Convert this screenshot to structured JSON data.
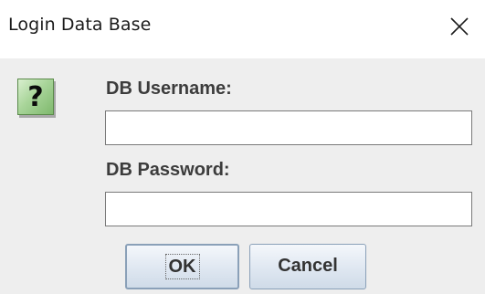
{
  "window": {
    "title": "Login Data Base",
    "close_icon": "close-icon"
  },
  "icon": {
    "name": "question-icon",
    "glyph": "?",
    "color": "#8cc47b"
  },
  "form": {
    "username_label": "DB Username:",
    "username_value": "",
    "password_label": "DB Password:",
    "password_value": ""
  },
  "buttons": {
    "ok_label": "OK",
    "cancel_label": "Cancel"
  }
}
